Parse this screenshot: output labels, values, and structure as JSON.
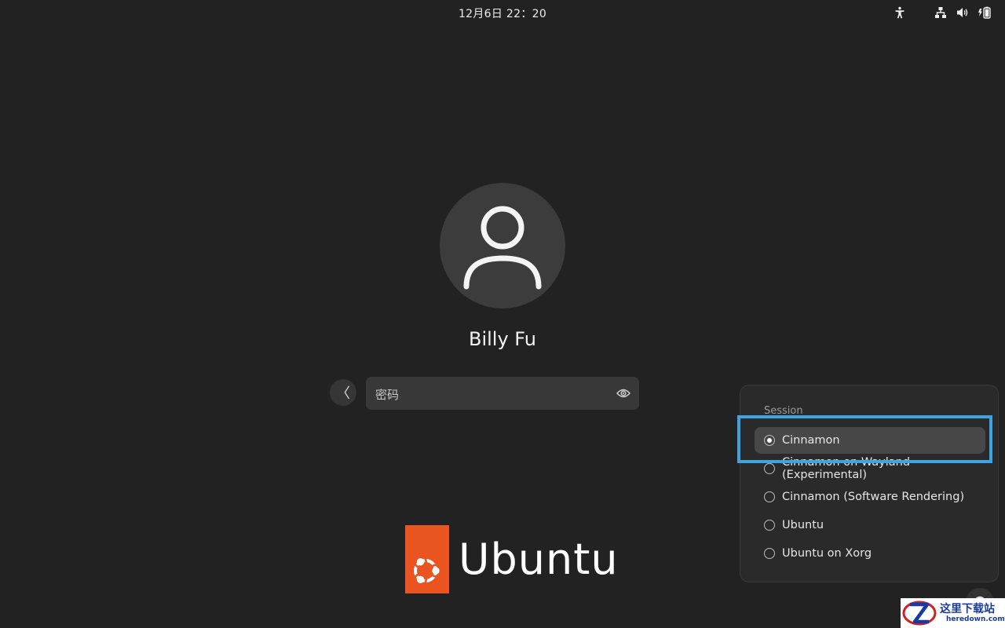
{
  "topbar": {
    "clock": "12月6日  22：20",
    "icons": [
      "accessibility-icon",
      "network-icon",
      "volume-icon",
      "battery-icon"
    ]
  },
  "login": {
    "username": "Billy Fu",
    "password_placeholder": "密码",
    "back_icon": "〈"
  },
  "branding": {
    "wordmark": "Ubuntu",
    "accent": "#e95420"
  },
  "session_menu": {
    "title": "Session",
    "items": [
      {
        "label": "Cinnamon",
        "selected": true
      },
      {
        "label": "Cinnamon on Wayland (Experimental)",
        "selected": false
      },
      {
        "label": "Cinnamon (Software Rendering)",
        "selected": false
      },
      {
        "label": "Ubuntu",
        "selected": false
      },
      {
        "label": "Ubuntu on Xorg",
        "selected": false
      }
    ],
    "highlight_color": "#3fa3e0"
  },
  "watermark": {
    "title": "这里下载站",
    "url": "heredown.com"
  }
}
